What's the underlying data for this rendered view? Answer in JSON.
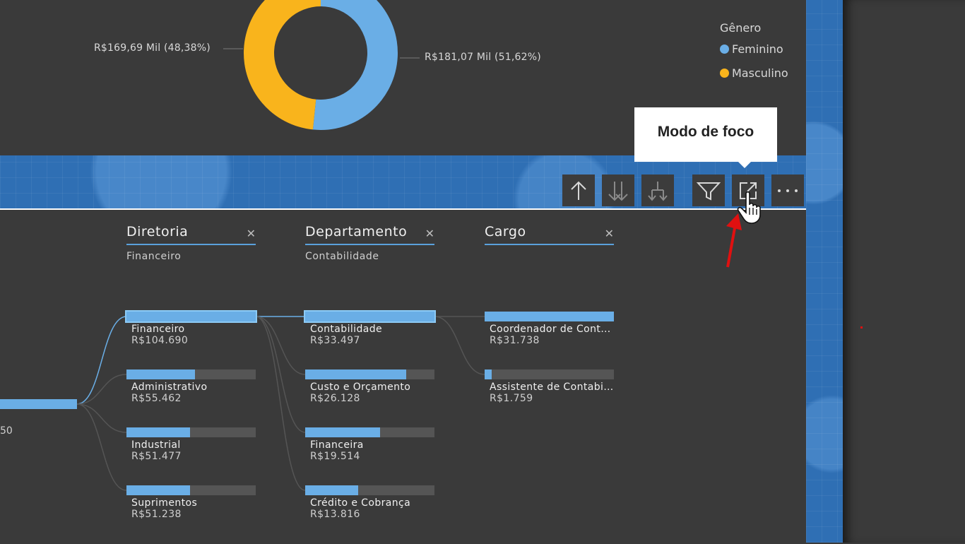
{
  "donut": {
    "left_label": "R$169,69 Mil (48,38%)",
    "right_label": "R$181,07 Mil (51,62%)",
    "slices": [
      {
        "name": "Feminino",
        "percent": 51.62,
        "color": "#6aaee6"
      },
      {
        "name": "Masculino",
        "percent": 48.38,
        "color": "#f9b41c"
      }
    ]
  },
  "legend": {
    "title": "Gênero",
    "items": [
      {
        "label": "Feminino",
        "color": "#6aaee6"
      },
      {
        "label": "Masculino",
        "color": "#f9b41c"
      }
    ]
  },
  "toolbar": {
    "tooltip": "Modo de foco",
    "icons": [
      "drill-up-icon",
      "drill-down-icon",
      "expand-hierarchy-icon",
      "filter-icon",
      "focus-mode-icon",
      "more-options-icon"
    ]
  },
  "tree": {
    "root_value": "50",
    "levels": [
      {
        "title": "Diretoria",
        "selected": "Financeiro",
        "nodes": [
          {
            "label": "Financeiro",
            "value": "R$104.690",
            "fraction": 1.0,
            "selected": true
          },
          {
            "label": "Administrativo",
            "value": "R$55.462",
            "fraction": 0.53
          },
          {
            "label": "Industrial",
            "value": "R$51.477",
            "fraction": 0.49
          },
          {
            "label": "Suprimentos",
            "value": "R$51.238",
            "fraction": 0.49
          }
        ]
      },
      {
        "title": "Departamento",
        "selected": "Contabilidade",
        "nodes": [
          {
            "label": "Contabilidade",
            "value": "R$33.497",
            "fraction": 1.0,
            "selected": true
          },
          {
            "label": "Custo e Orçamento",
            "value": "R$26.128",
            "fraction": 0.78
          },
          {
            "label": "Financeira",
            "value": "R$19.514",
            "fraction": 0.58
          },
          {
            "label": "Crédito e Cobrança",
            "value": "R$13.816",
            "fraction": 0.41
          }
        ]
      },
      {
        "title": "Cargo",
        "selected": "",
        "nodes": [
          {
            "label": "Coordenador de Contabilidade",
            "value": "R$31.738",
            "fraction": 1.0
          },
          {
            "label": "Assistente de Contabilidade",
            "value": "R$1.759",
            "fraction": 0.055
          }
        ]
      }
    ]
  }
}
